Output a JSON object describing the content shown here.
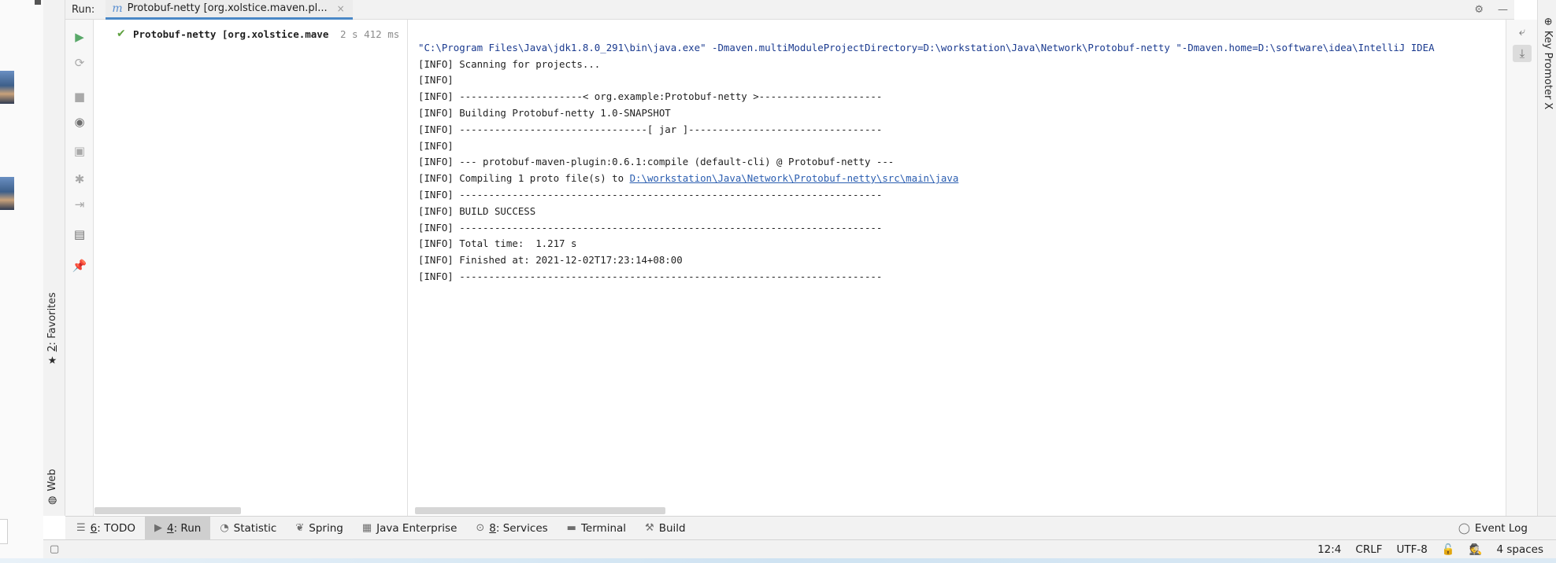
{
  "run_panel": {
    "label": "Run:",
    "tab_icon": "m",
    "tab_title": "Protobuf-netty [org.xolstice.maven.pl...",
    "close_glyph": "×"
  },
  "toolbar_icons": [
    "rerun-icon",
    "rerun-failed-icon",
    "stop-icon",
    "eye-icon",
    "camera-icon",
    "debug-icon",
    "exit-icon",
    "layout-icon",
    "pin-icon"
  ],
  "tree": {
    "name": "Protobuf-netty [org.xolstice.mave",
    "time": "2 s 412 ms"
  },
  "console": {
    "command": "\"C:\\Program Files\\Java\\jdk1.8.0_291\\bin\\java.exe\" -Dmaven.multiModuleProjectDirectory=D:\\workstation\\Java\\Network\\Protobuf-netty \"-Dmaven.home=D:\\software\\idea\\IntelliJ IDEA",
    "lines": [
      "[INFO] Scanning for projects...",
      "[INFO]",
      "[INFO] ---------------------< org.example:Protobuf-netty >---------------------",
      "[INFO] Building Protobuf-netty 1.0-SNAPSHOT",
      "[INFO] --------------------------------[ jar ]---------------------------------",
      "[INFO]",
      "[INFO] --- protobuf-maven-plugin:0.6.1:compile (default-cli) @ Protobuf-netty ---"
    ],
    "compile_prefix": "[INFO] Compiling 1 proto file(s) to ",
    "compile_link": "D:\\workstation\\Java\\Network\\Protobuf-netty\\src\\main\\java",
    "tail_lines": [
      "[INFO] ------------------------------------------------------------------------",
      "[INFO] BUILD SUCCESS",
      "[INFO] ------------------------------------------------------------------------",
      "[INFO] Total time:  1.217 s",
      "[INFO] Finished at: 2021-12-02T17:23:14+08:00",
      "[INFO] ------------------------------------------------------------------------"
    ]
  },
  "left_stripe": {
    "favorites_number": "2",
    "favorites_label": ": Favorites",
    "web_label": "Web"
  },
  "right_stripe": {
    "key_promoter": "Key Promoter X"
  },
  "bottom_tabs": [
    {
      "num": "6",
      "label": ": TODO",
      "icon": "list-icon"
    },
    {
      "num": "4",
      "label": ": Run",
      "icon": "play-icon",
      "active": true
    },
    {
      "num": "",
      "label": "Statistic",
      "icon": "pie-icon"
    },
    {
      "num": "",
      "label": "Spring",
      "icon": "leaf-icon"
    },
    {
      "num": "",
      "label": "Java Enterprise",
      "icon": "enterprise-icon"
    },
    {
      "num": "8",
      "label": ": Services",
      "icon": "services-icon"
    },
    {
      "num": "",
      "label": "Terminal",
      "icon": "terminal-icon"
    },
    {
      "num": "",
      "label": "Build",
      "icon": "hammer-icon"
    }
  ],
  "event_log": "Event Log",
  "status": {
    "position": "12:4",
    "line_sep": "CRLF",
    "encoding": "UTF-8",
    "indent": "4 spaces"
  }
}
